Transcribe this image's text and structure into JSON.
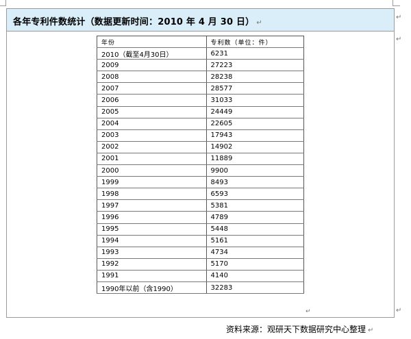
{
  "title": "各年专利件数统计（数据更新时间：2010 年 4 月 30 日）",
  "paragraph_mark": "↵",
  "table": {
    "headers": [
      "年份",
      "专利数（单位：件）"
    ],
    "rows": [
      [
        "2010（截至4月30日）",
        "6231"
      ],
      [
        "2009",
        "27223"
      ],
      [
        "2008",
        "28238"
      ],
      [
        "2007",
        "28577"
      ],
      [
        "2006",
        "31033"
      ],
      [
        "2005",
        "24449"
      ],
      [
        "2004",
        "22605"
      ],
      [
        "2003",
        "17943"
      ],
      [
        "2002",
        "14902"
      ],
      [
        "2001",
        "11889"
      ],
      [
        "2000",
        "9900"
      ],
      [
        "1999",
        "8493"
      ],
      [
        "1998",
        "6593"
      ],
      [
        "1997",
        "5381"
      ],
      [
        "1996",
        "4789"
      ],
      [
        "1995",
        "5448"
      ],
      [
        "1994",
        "5161"
      ],
      [
        "1993",
        "4734"
      ],
      [
        "1992",
        "5170"
      ],
      [
        "1991",
        "4140"
      ],
      [
        "1990年以前（含1990）",
        "32283"
      ]
    ]
  },
  "source": "资料来源：观研天下数据研究中心整理"
}
